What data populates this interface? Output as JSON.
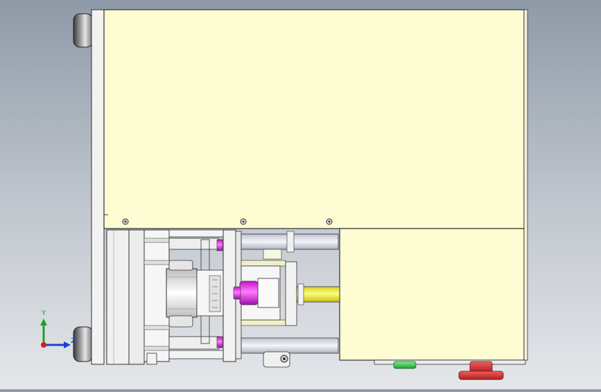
{
  "viewport": {
    "view": "Front",
    "background": [
      "#8f9aa8",
      "#e4e7ea"
    ]
  },
  "triad": {
    "axes": [
      {
        "label": "Y",
        "color": "#1fa030"
      },
      {
        "label": "Z",
        "color": "#1f3fd0"
      }
    ],
    "origin_color": "#d01f1f"
  },
  "colors": {
    "housing": "#fdfcd2",
    "outline": "#303030",
    "magenta_part": "#e11ee8",
    "yellow_rod": "#f7f044",
    "green_part": "#2fd050",
    "red_part": "#d8302c",
    "metal": "#e8e8e8",
    "dark_roller": "#505050"
  }
}
